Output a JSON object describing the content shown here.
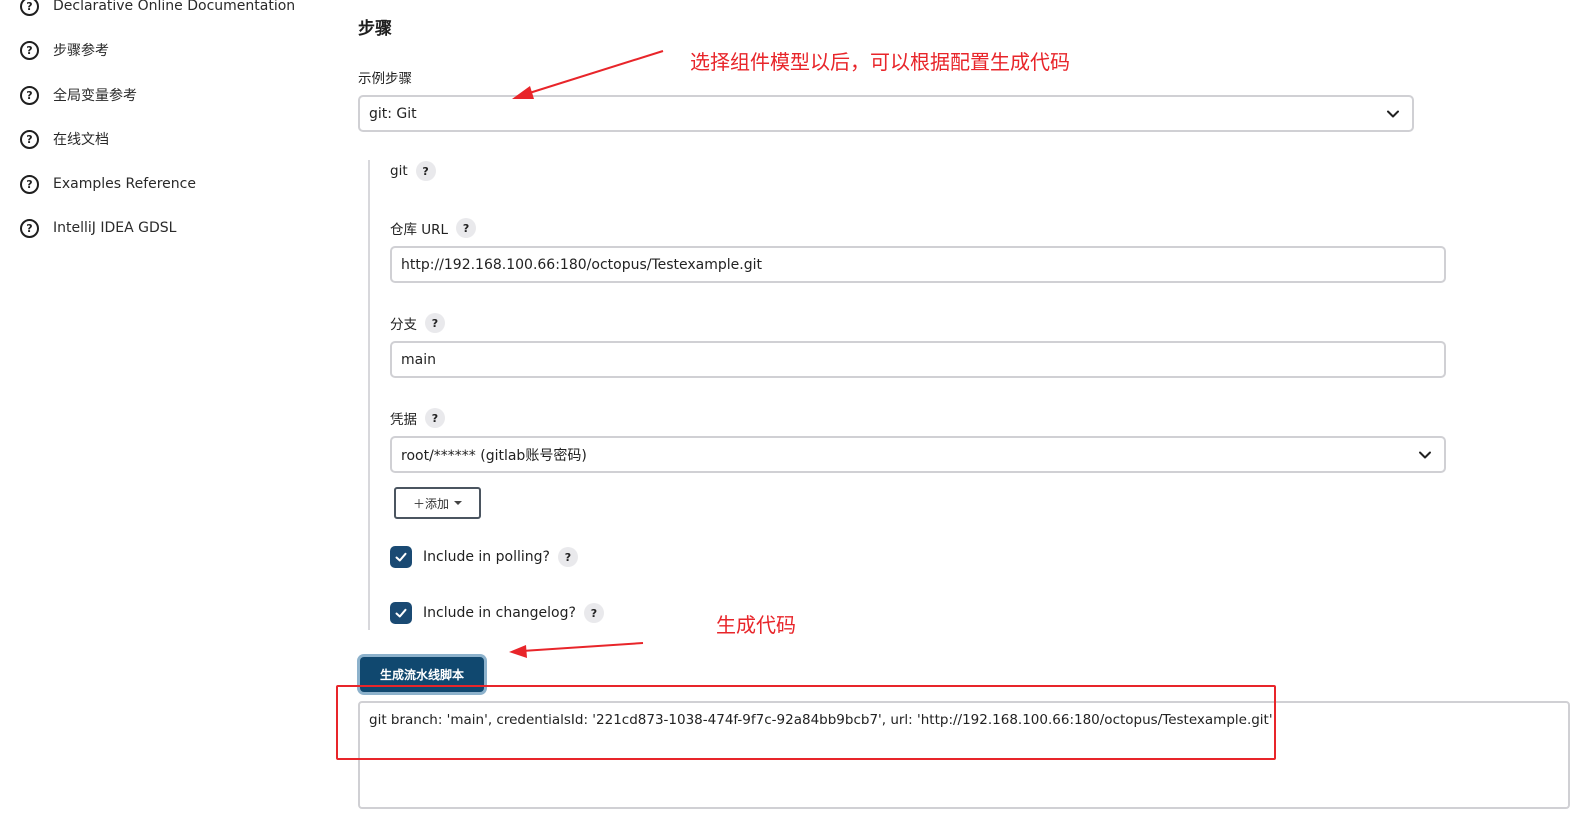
{
  "sidebar": {
    "items": [
      {
        "label": "Declarative Online Documentation"
      },
      {
        "label": "步骤参考"
      },
      {
        "label": "全局变量参考"
      },
      {
        "label": "在线文档"
      },
      {
        "label": "Examples Reference"
      },
      {
        "label": "IntelliJ IDEA GDSL"
      }
    ],
    "help_glyph": "?"
  },
  "main": {
    "section_title": "步骤",
    "sample_step": {
      "label": "示例步骤",
      "value": "git: Git"
    },
    "config": {
      "step_name": "git",
      "repo_url": {
        "label": "仓库 URL",
        "value": "http://192.168.100.66:180/octopus/Testexample.git"
      },
      "branch": {
        "label": "分支",
        "value": "main"
      },
      "credentials": {
        "label": "凭据",
        "value": "root/****** (gitlab账号密码)"
      },
      "add_button": "＋添加",
      "include_polling": {
        "label": "Include in polling?",
        "checked": true
      },
      "include_changelog": {
        "label": "Include in changelog?",
        "checked": true
      }
    },
    "generate_button": "生成流水线脚本",
    "output": "git branch: 'main', credentialsId: '221cd873-1038-474f-9f7c-92a84bb9bcb7', url: 'http://192.168.100.66:180/octopus/Testexample.git'"
  },
  "annotations": {
    "top": "选择组件模型以后，可以根据配置生成代码",
    "bottom": "生成代码",
    "color": "#e8252a"
  },
  "colors": {
    "primary": "#10486f",
    "checkbox": "#1a4a73",
    "annotation": "#e8252a"
  }
}
